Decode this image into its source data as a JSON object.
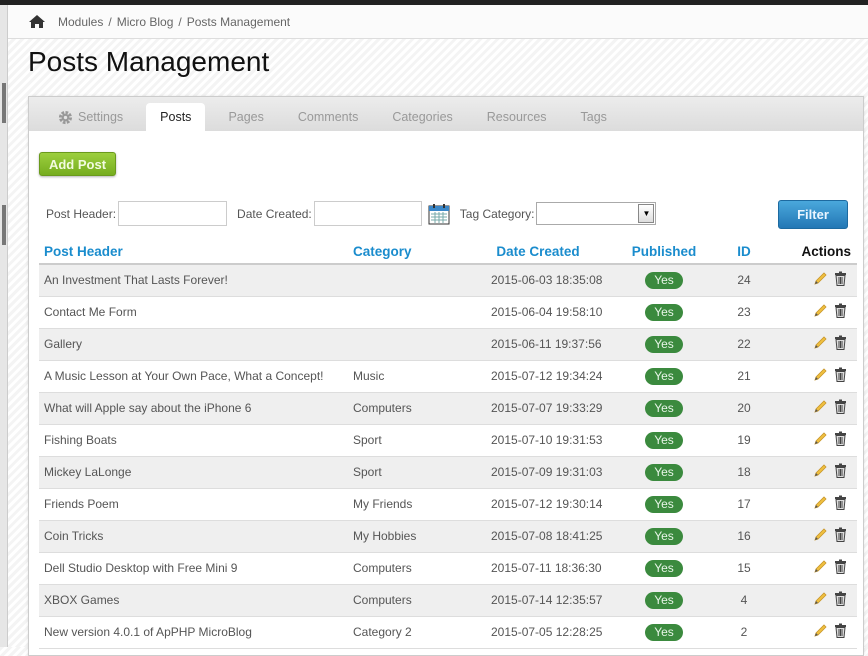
{
  "breadcrumb": [
    "Modules",
    "Micro Blog",
    "Posts Management"
  ],
  "title": "Posts Management",
  "tabs": [
    "Settings",
    "Posts",
    "Pages",
    "Comments",
    "Categories",
    "Resources",
    "Tags"
  ],
  "add_label": "Add Post",
  "filters": {
    "post_header": "Post Header:",
    "date_created": "Date Created:",
    "tag_category": "Tag Category:",
    "button": "Filter"
  },
  "columns": [
    "Post Header",
    "Category",
    "Date Created",
    "Published",
    "ID",
    "Actions"
  ],
  "rows": [
    [
      "An Investment That Lasts Forever!",
      "",
      "2015-06-03 18:35:08",
      "Yes",
      "24"
    ],
    [
      "Contact Me Form",
      "",
      "2015-06-04 19:58:10",
      "Yes",
      "23"
    ],
    [
      "Gallery",
      "",
      "2015-06-11 19:37:56",
      "Yes",
      "22"
    ],
    [
      "A Music Lesson at Your Own Pace, What a Concept!",
      "Music",
      "2015-07-12 19:34:24",
      "Yes",
      "21"
    ],
    [
      "What will Apple say about the iPhone 6",
      "Computers",
      "2015-07-07 19:33:29",
      "Yes",
      "20"
    ],
    [
      "Fishing Boats",
      "Sport",
      "2015-07-10 19:31:53",
      "Yes",
      "19"
    ],
    [
      "Mickey LaLonge",
      "Sport",
      "2015-07-09 19:31:03",
      "Yes",
      "18"
    ],
    [
      "Friends Poem",
      "My Friends",
      "2015-07-12 19:30:14",
      "Yes",
      "17"
    ],
    [
      "Coin Tricks",
      "My Hobbies",
      "2015-07-08 18:41:25",
      "Yes",
      "16"
    ],
    [
      "Dell Studio Desktop with Free Mini 9",
      "Computers",
      "2015-07-11 18:36:30",
      "Yes",
      "15"
    ],
    [
      "XBOX Games",
      "Computers",
      "2015-07-14 12:35:57",
      "Yes",
      "4"
    ],
    [
      "New version 4.0.1 of ApPHP MicroBlog",
      "Category 2",
      "2015-07-05 12:28:25",
      "Yes",
      "2"
    ]
  ]
}
